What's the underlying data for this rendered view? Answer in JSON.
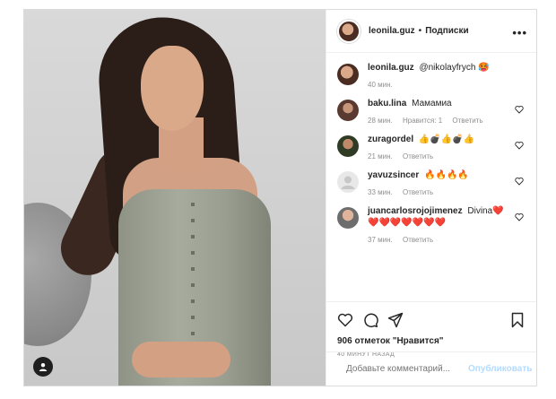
{
  "post": {
    "username": "leonila.guz",
    "separator": "•",
    "follow_label": "Подписки",
    "more_glyph": "•••"
  },
  "caption": {
    "username": "leonila.guz",
    "text": "@nikolayfrych 🥵",
    "time": "40 мин."
  },
  "comments": [
    {
      "username": "baku.lina",
      "text": "Мамамиа",
      "time": "28 мин.",
      "likes": "Нравится: 1",
      "reply": "Ответить"
    },
    {
      "username": "zuragordel",
      "text": "👍💣👍💣👍",
      "time": "21 мин.",
      "reply": "Ответить"
    },
    {
      "username": "yavuzsincer",
      "text": "🔥🔥🔥🔥",
      "time": "33 мин.",
      "reply": "Ответить"
    },
    {
      "username": "juancarlosrojojimenez",
      "text": "Divina❤️ ❤️❤️❤️❤️❤️❤️❤️",
      "time": "37 мин.",
      "reply": "Ответить"
    }
  ],
  "stats": {
    "likes": "906 отметок \"Нравится\"",
    "posted": "40 МИНУТ НАЗАД"
  },
  "composer": {
    "placeholder": "Добавьте комментарий...",
    "post_label": "Опубликовать"
  },
  "icons": [
    "heart-icon",
    "comment-icon",
    "share-icon",
    "bookmark-icon",
    "emoji-icon",
    "user-tag-icon",
    "more-icon"
  ]
}
